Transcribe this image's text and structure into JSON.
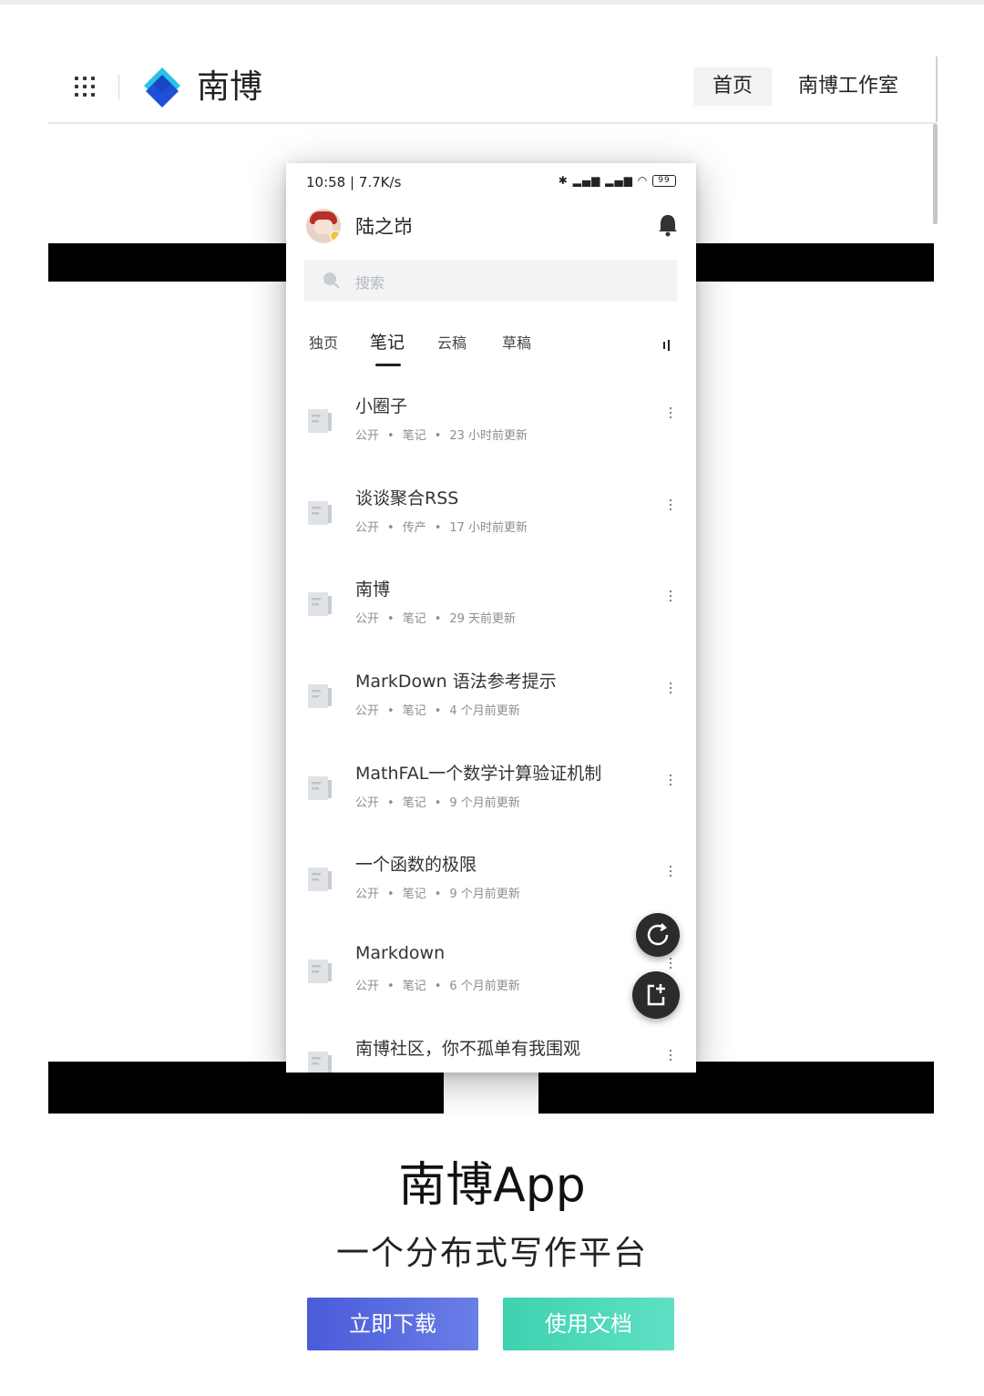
{
  "site": {
    "brand": "南博",
    "nav": {
      "home": "首页",
      "studio": "南博工作室"
    }
  },
  "phone": {
    "status": {
      "time_speed": "10:58 | 7.7K/s",
      "battery": "99"
    },
    "user": {
      "name": "陆之岇"
    },
    "search": {
      "placeholder": "搜索"
    },
    "tabs": [
      {
        "label": "独页"
      },
      {
        "label": "笔记",
        "active": true
      },
      {
        "label": "云稿"
      },
      {
        "label": "草稿"
      }
    ],
    "notes": [
      {
        "title": "小圈子",
        "visibility": "公开",
        "type": "笔记",
        "updated": "23 小时前更新"
      },
      {
        "title": "谈谈聚合RSS",
        "visibility": "公开",
        "type": "传产",
        "updated": "17 小时前更新"
      },
      {
        "title": "南博",
        "visibility": "公开",
        "type": "笔记",
        "updated": "29 天前更新"
      },
      {
        "title": "MarkDown 语法参考提示",
        "visibility": "公开",
        "type": "笔记",
        "updated": "4 个月前更新"
      },
      {
        "title": "MathFAL一个数学计算验证机制",
        "visibility": "公开",
        "type": "笔记",
        "updated": "9 个月前更新"
      },
      {
        "title": "一个函数的极限",
        "visibility": "公开",
        "type": "笔记",
        "updated": "9 个月前更新"
      },
      {
        "title": "Markdown",
        "visibility": "公开",
        "type": "笔记",
        "updated": "6 个月前更新"
      },
      {
        "title": "南博社区，你不孤单有我围观",
        "visibility": "",
        "type": "",
        "updated": ""
      }
    ],
    "meta_separator": "•"
  },
  "hero": {
    "title": "南博App",
    "subtitle": "一个分布式写作平台",
    "download_label": "立即下载",
    "docs_label": "使用文档"
  },
  "colors": {
    "download_button": "#4a5bd8",
    "docs_button": "#3fd1b0",
    "logo_cyan": "#29c3e6",
    "logo_blue": "#1f4fd6"
  },
  "icons": [
    "grid-menu-icon",
    "logo-icon",
    "bell-icon",
    "search-icon",
    "document-icon",
    "more-vertical-icon",
    "refresh-icon",
    "new-note-icon"
  ]
}
